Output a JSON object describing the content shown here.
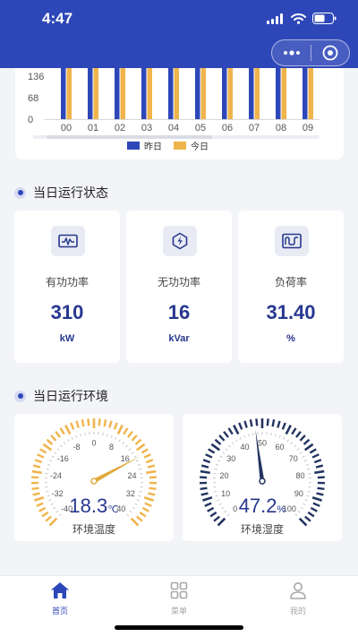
{
  "status_bar": {
    "time": "4:47"
  },
  "chart_data": {
    "type": "bar",
    "categories": [
      "00",
      "01",
      "02",
      "03",
      "04",
      "05",
      "06",
      "07",
      "08",
      "09"
    ],
    "series": [
      {
        "name": "昨日",
        "color": "#2e47b8",
        "values": [
          250,
          250,
          250,
          250,
          252,
          248,
          260,
          262,
          268,
          258
        ]
      },
      {
        "name": "今日",
        "color": "#f0b44c",
        "values": [
          268,
          270,
          270,
          268,
          262,
          258,
          262,
          266,
          274,
          253
        ]
      }
    ],
    "yticks": [
      "0",
      "68",
      "136"
    ],
    "ylim": [
      0,
      204
    ],
    "legend_position": "bottom"
  },
  "run_status": {
    "title": "当日运行状态",
    "cards": [
      {
        "label": "有功功率",
        "value": "310",
        "unit": "kW",
        "icon": "waveform-icon"
      },
      {
        "label": "无功功率",
        "value": "16",
        "unit": "kVar",
        "icon": "lightning-icon"
      },
      {
        "label": "负荷率",
        "value": "31.40",
        "unit": "%",
        "icon": "load-curve-icon"
      }
    ]
  },
  "environment": {
    "title": "当日运行环境",
    "temperature": {
      "value": "18.3",
      "value_num": 18.3,
      "unit": "℃",
      "label": "环境温度",
      "ticks": [
        "-40",
        "-32",
        "-24",
        "-16",
        "-8",
        "0",
        "8",
        "16",
        "24",
        "32",
        "40"
      ],
      "min": -40,
      "max": 40,
      "color": "#f0b44c"
    },
    "humidity": {
      "value": "47.2",
      "value_num": 47.2,
      "unit": "%",
      "label": "环境湿度",
      "ticks": [
        "0",
        "10",
        "20",
        "30",
        "40",
        "50",
        "60",
        "70",
        "80",
        "90",
        "100"
      ],
      "min": 0,
      "max": 100,
      "color": "#23345f"
    }
  },
  "tabbar": {
    "active_color": "#2e47b8",
    "inactive_color": "#a7a7a7",
    "items": [
      {
        "label": "首页",
        "icon": "home-icon"
      },
      {
        "label": "菜单",
        "icon": "grid-icon"
      },
      {
        "label": "我的",
        "icon": "user-icon"
      }
    ]
  }
}
